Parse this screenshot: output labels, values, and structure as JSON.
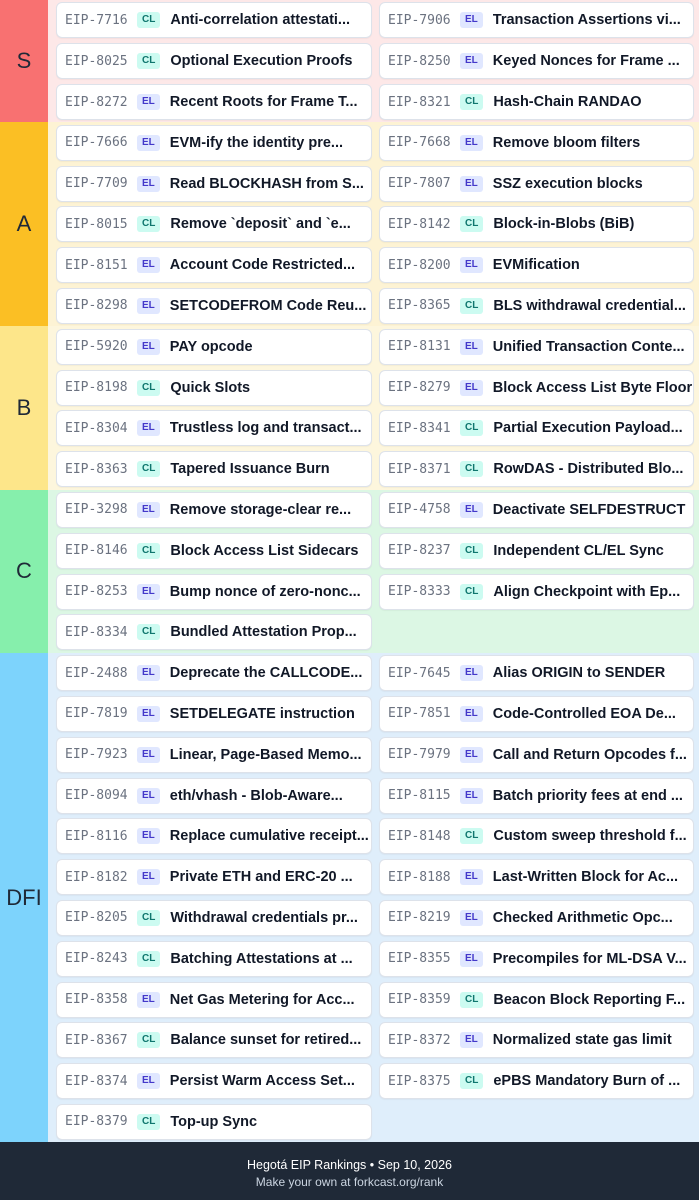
{
  "colors": {
    "tier_S": "#f87171",
    "tier_S_bg": "#fde8e8",
    "tier_A": "#fbbf24",
    "tier_A_bg": "#fdf3d4",
    "tier_B": "#fde68a",
    "tier_B_bg": "#fdf6dd",
    "tier_C": "#86efac",
    "tier_C_bg": "#dcf7e4",
    "tier_DFI": "#7dd3fc",
    "tier_DFI_bg": "#dfeefb",
    "footer_bg": "#1f2937"
  },
  "tiers": [
    {
      "label": "S",
      "items": [
        {
          "eip": "EIP-7716",
          "layer": "CL",
          "title": "Anti-correlation attestati..."
        },
        {
          "eip": "EIP-7906",
          "layer": "EL",
          "title": "Transaction Assertions vi..."
        },
        {
          "eip": "EIP-8025",
          "layer": "CL",
          "title": "Optional Execution Proofs"
        },
        {
          "eip": "EIP-8250",
          "layer": "EL",
          "title": "Keyed Nonces for Frame ..."
        },
        {
          "eip": "EIP-8272",
          "layer": "EL",
          "title": "Recent Roots for Frame T..."
        },
        {
          "eip": "EIP-8321",
          "layer": "CL",
          "title": "Hash-Chain RANDAO"
        }
      ]
    },
    {
      "label": "A",
      "items": [
        {
          "eip": "EIP-7666",
          "layer": "EL",
          "title": "EVM-ify the identity pre..."
        },
        {
          "eip": "EIP-7668",
          "layer": "EL",
          "title": "Remove bloom filters"
        },
        {
          "eip": "EIP-7709",
          "layer": "EL",
          "title": "Read BLOCKHASH from S..."
        },
        {
          "eip": "EIP-7807",
          "layer": "EL",
          "title": "SSZ execution blocks"
        },
        {
          "eip": "EIP-8015",
          "layer": "CL",
          "title": "Remove `deposit` and `e..."
        },
        {
          "eip": "EIP-8142",
          "layer": "CL",
          "title": "Block-in-Blobs (BiB)"
        },
        {
          "eip": "EIP-8151",
          "layer": "EL",
          "title": "Account Code Restricted..."
        },
        {
          "eip": "EIP-8200",
          "layer": "EL",
          "title": "EVMification"
        },
        {
          "eip": "EIP-8298",
          "layer": "EL",
          "title": "SETCODEFROM Code Reu..."
        },
        {
          "eip": "EIP-8365",
          "layer": "CL",
          "title": "BLS withdrawal credential..."
        }
      ]
    },
    {
      "label": "B",
      "items": [
        {
          "eip": "EIP-5920",
          "layer": "EL",
          "title": "PAY opcode"
        },
        {
          "eip": "EIP-8131",
          "layer": "EL",
          "title": "Unified Transaction Conte..."
        },
        {
          "eip": "EIP-8198",
          "layer": "CL",
          "title": "Quick Slots"
        },
        {
          "eip": "EIP-8279",
          "layer": "EL",
          "title": "Block Access List Byte Floor"
        },
        {
          "eip": "EIP-8304",
          "layer": "EL",
          "title": "Trustless log and transact..."
        },
        {
          "eip": "EIP-8341",
          "layer": "CL",
          "title": "Partial Execution Payload..."
        },
        {
          "eip": "EIP-8363",
          "layer": "CL",
          "title": "Tapered Issuance Burn"
        },
        {
          "eip": "EIP-8371",
          "layer": "CL",
          "title": "RowDAS - Distributed Blo..."
        }
      ]
    },
    {
      "label": "C",
      "items": [
        {
          "eip": "EIP-3298",
          "layer": "EL",
          "title": "Remove storage-clear re..."
        },
        {
          "eip": "EIP-4758",
          "layer": "EL",
          "title": "Deactivate SELFDESTRUCT"
        },
        {
          "eip": "EIP-8146",
          "layer": "CL",
          "title": "Block Access List Sidecars"
        },
        {
          "eip": "EIP-8237",
          "layer": "CL",
          "title": "Independent CL/EL Sync"
        },
        {
          "eip": "EIP-8253",
          "layer": "EL",
          "title": "Bump nonce of zero-nonc..."
        },
        {
          "eip": "EIP-8333",
          "layer": "CL",
          "title": "Align Checkpoint with Ep..."
        },
        {
          "eip": "EIP-8334",
          "layer": "CL",
          "title": "Bundled Attestation Prop..."
        }
      ]
    },
    {
      "label": "DFI",
      "items": [
        {
          "eip": "EIP-2488",
          "layer": "EL",
          "title": "Deprecate the CALLCODE..."
        },
        {
          "eip": "EIP-7645",
          "layer": "EL",
          "title": "Alias ORIGIN to SENDER"
        },
        {
          "eip": "EIP-7819",
          "layer": "EL",
          "title": "SETDELEGATE instruction"
        },
        {
          "eip": "EIP-7851",
          "layer": "EL",
          "title": "Code-Controlled EOA De..."
        },
        {
          "eip": "EIP-7923",
          "layer": "EL",
          "title": "Linear, Page-Based Memo..."
        },
        {
          "eip": "EIP-7979",
          "layer": "EL",
          "title": "Call and Return Opcodes f..."
        },
        {
          "eip": "EIP-8094",
          "layer": "EL",
          "title": "eth/vhash - Blob-Aware..."
        },
        {
          "eip": "EIP-8115",
          "layer": "EL",
          "title": "Batch priority fees at end ..."
        },
        {
          "eip": "EIP-8116",
          "layer": "EL",
          "title": "Replace cumulative receipt..."
        },
        {
          "eip": "EIP-8148",
          "layer": "CL",
          "title": "Custom sweep threshold f..."
        },
        {
          "eip": "EIP-8182",
          "layer": "EL",
          "title": "Private ETH and ERC-20 ..."
        },
        {
          "eip": "EIP-8188",
          "layer": "EL",
          "title": "Last-Written Block for Ac..."
        },
        {
          "eip": "EIP-8205",
          "layer": "CL",
          "title": "Withdrawal credentials pr..."
        },
        {
          "eip": "EIP-8219",
          "layer": "EL",
          "title": "Checked Arithmetic Opc..."
        },
        {
          "eip": "EIP-8243",
          "layer": "CL",
          "title": "Batching Attestations at ..."
        },
        {
          "eip": "EIP-8355",
          "layer": "EL",
          "title": "Precompiles for ML-DSA V..."
        },
        {
          "eip": "EIP-8358",
          "layer": "EL",
          "title": "Net Gas Metering for Acc..."
        },
        {
          "eip": "EIP-8359",
          "layer": "CL",
          "title": "Beacon Block Reporting F..."
        },
        {
          "eip": "EIP-8367",
          "layer": "CL",
          "title": "Balance sunset for retired..."
        },
        {
          "eip": "EIP-8372",
          "layer": "EL",
          "title": "Normalized state gas limit"
        },
        {
          "eip": "EIP-8374",
          "layer": "EL",
          "title": "Persist Warm Access Set..."
        },
        {
          "eip": "EIP-8375",
          "layer": "CL",
          "title": "ePBS Mandatory Burn of ..."
        },
        {
          "eip": "EIP-8379",
          "layer": "CL",
          "title": "Top-up Sync"
        }
      ]
    }
  ],
  "footer": {
    "line1": "Hegotá EIP Rankings • Sep 10, 2026",
    "line2": "Make your own at forkcast.org/rank"
  }
}
